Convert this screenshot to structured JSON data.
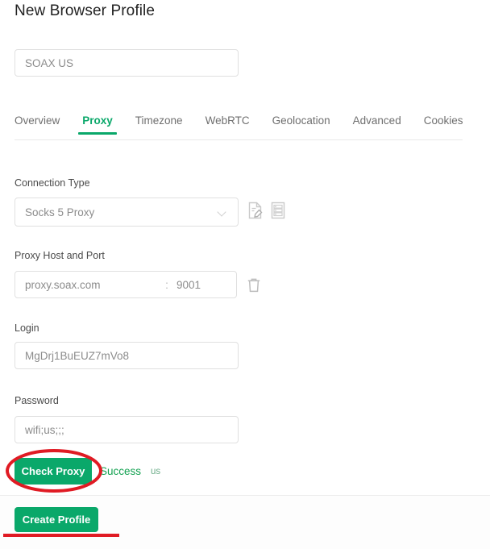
{
  "page": {
    "title": "New Browser Profile"
  },
  "profile_name": {
    "value": "SOAX US",
    "placeholder": "Profile name"
  },
  "tabs": [
    {
      "label": "Overview",
      "active": false
    },
    {
      "label": "Proxy",
      "active": true
    },
    {
      "label": "Timezone",
      "active": false
    },
    {
      "label": "WebRTC",
      "active": false
    },
    {
      "label": "Geolocation",
      "active": false
    },
    {
      "label": "Advanced",
      "active": false
    },
    {
      "label": "Cookies",
      "active": false
    }
  ],
  "proxy_form": {
    "connection_type": {
      "label": "Connection Type",
      "value": "Socks 5 Proxy",
      "chevron_icon": "chevron-down-icon",
      "paste_icon": "document-edit-icon",
      "list_icon": "proxy-list-icon"
    },
    "host_port": {
      "label": "Proxy Host and Port",
      "host": "proxy.soax.com",
      "separator": ":",
      "port": "9001",
      "delete_icon": "trash-icon"
    },
    "login": {
      "label": "Login",
      "value": "MgDrj1BuEUZ7mVo8"
    },
    "password": {
      "label": "Password",
      "value": "wifi;us;;;"
    },
    "check_proxy_button": "Check Proxy",
    "status_text": "Success",
    "status_region": "us"
  },
  "footer": {
    "create_button": "Create Profile"
  },
  "colors": {
    "accent_green": "#0aa86a",
    "status_green": "#12a150",
    "annotation_red": "#e01b24",
    "text_gray": "#8c8c8c",
    "border_gray": "#e0e0e0"
  },
  "annotations": {
    "ellipse_target": "check-proxy-button",
    "underline_target": "create-profile-button"
  }
}
